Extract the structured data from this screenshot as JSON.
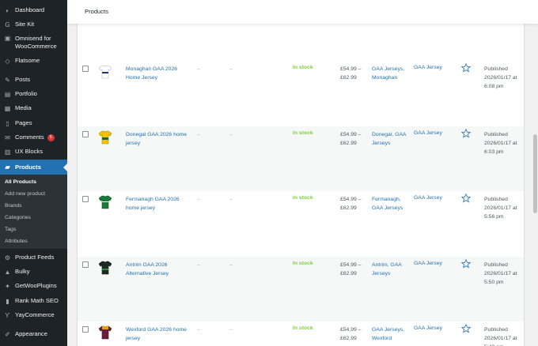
{
  "topbar": {
    "title": "Products"
  },
  "sidebar": {
    "items": [
      {
        "label": "Dashboard",
        "icon": "dashboard-icon"
      },
      {
        "label": "Site Kit",
        "icon": "sitekit-icon"
      },
      {
        "label": "Omnisend for WooCommerce",
        "icon": "omnisend-icon"
      },
      {
        "label": "Flatsome",
        "icon": "flatsome-icon"
      },
      {
        "label": "Posts",
        "icon": "pin-icon"
      },
      {
        "label": "Portfolio",
        "icon": "portfolio-icon"
      },
      {
        "label": "Media",
        "icon": "media-icon"
      },
      {
        "label": "Pages",
        "icon": "pages-icon"
      },
      {
        "label": "Comments",
        "icon": "comments-icon",
        "badge": "5"
      },
      {
        "label": "UX Blocks",
        "icon": "blocks-icon"
      },
      {
        "label": "Products",
        "icon": "products-icon"
      },
      {
        "label": "Product Feeds",
        "icon": "feeds-icon"
      },
      {
        "label": "Bulky",
        "icon": "bulky-icon"
      },
      {
        "label": "GetWooPlugins",
        "icon": "plugins-icon"
      },
      {
        "label": "Rank Math SEO",
        "icon": "rankmath-icon"
      },
      {
        "label": "YayCommerce",
        "icon": "yay-icon"
      },
      {
        "label": "Appearance",
        "icon": "appearance-icon"
      }
    ],
    "submenu": [
      "All Products",
      "Add new product",
      "Brands",
      "Categories",
      "Tags",
      "Attributes"
    ]
  },
  "products": [
    {
      "name": "Monaghan GAA 2026 Home Jersey",
      "sku": "–",
      "weight": "–",
      "stock": "In stock",
      "price_low": "£54.99 –",
      "price_high": "£62.99",
      "categories": "GAA Jerseys, Monaghan",
      "tags": "GAA Jersey",
      "date": "Published 2026/01/17 at 6:08 pm",
      "jersey_color": "#ffffff",
      "jersey_trim": "#1e3a7a"
    },
    {
      "name": "Donegal GAA 2026 home jersey",
      "sku": "–",
      "weight": "–",
      "stock": "In stock",
      "price_low": "£54.99 –",
      "price_high": "£62.99",
      "categories": "Donegal, GAA Jerseys",
      "tags": "GAA Jersey",
      "date": "Published 2026/01/17 at 6:03 pm",
      "jersey_color": "#f2c200",
      "jersey_trim": "#0c6b2e"
    },
    {
      "name": "Fermanagh GAA 2026 home jersey",
      "sku": "–",
      "weight": "–",
      "stock": "In stock",
      "price_low": "£54.99 –",
      "price_high": "£62.99",
      "categories": "Fermanagh, GAA Jerseys",
      "tags": "GAA Jersey",
      "date": "Published 2026/01/17 at 5:56 pm",
      "jersey_color": "#1a7a3a",
      "jersey_trim": "#ffffff"
    },
    {
      "name": "Antrim GAA 2026 Alternative Jersey",
      "sku": "–",
      "weight": "–",
      "stock": "In stock",
      "price_low": "£54.99 –",
      "price_high": "£62.99",
      "categories": "Antrim, GAA Jerseys",
      "tags": "GAA Jersey",
      "date": "Published 2026/01/17 at 5:50 pm",
      "jersey_color": "#1c2b22",
      "jersey_trim": "#2e8b3e"
    },
    {
      "name": "Wexford GAA 2026 home jersey",
      "sku": "–",
      "weight": "–",
      "stock": "In stock",
      "price_low": "£54.99 –",
      "price_high": "£62.99",
      "categories": "GAA Jerseys, Wexford",
      "tags": "GAA Jersey",
      "date": "Published 2026/01/17 at 5:42 pm",
      "jersey_color": "#6b1d3d",
      "jersey_trim": "#e0a800"
    }
  ],
  "colors": {
    "accent": "#2271b1",
    "sidebar_bg": "#1d2327",
    "in_stock": "#7ad03a"
  }
}
